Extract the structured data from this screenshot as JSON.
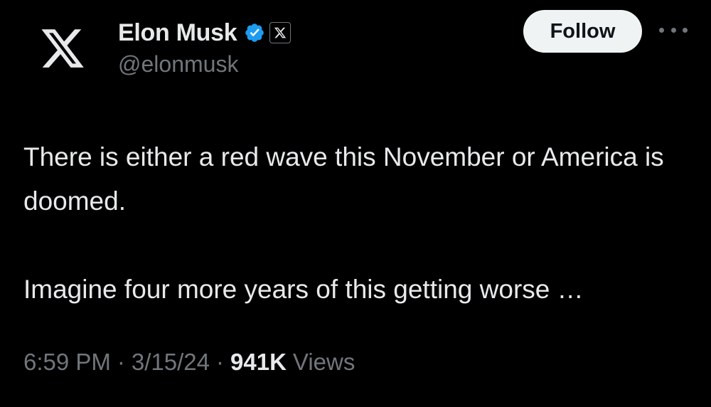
{
  "author": {
    "display_name": "Elon Musk",
    "handle": "@elonmusk",
    "avatar_icon": "x-logo-icon",
    "verified_icon": "verified-badge-icon",
    "affiliate_icon": "x-affiliate-badge-icon",
    "verified_color": "#1d9bf0"
  },
  "actions": {
    "follow_label": "Follow",
    "more_icon": "more-horizontal-icon"
  },
  "tweet": {
    "paragraphs": [
      "There is either a red wave this November or America is doomed.",
      "Imagine four more years of this getting worse …"
    ]
  },
  "meta": {
    "time": "6:59 PM",
    "separator": "·",
    "date": "3/15/24",
    "views_count": "941K",
    "views_label": "Views"
  },
  "colors": {
    "background": "#000000",
    "primary_text": "#e7e9ea",
    "secondary_text": "#71767b",
    "follow_bg": "#eff3f4"
  }
}
